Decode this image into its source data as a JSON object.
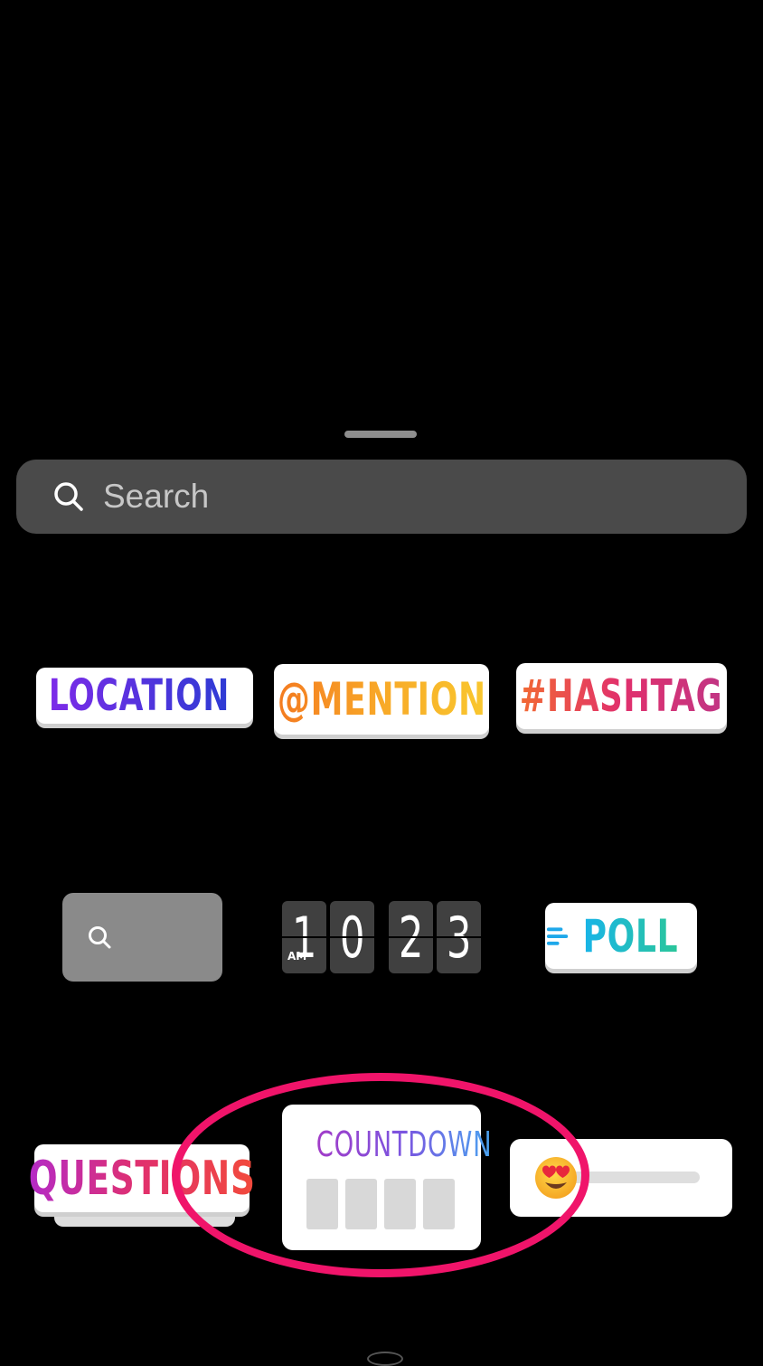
{
  "search": {
    "placeholder": "Search"
  },
  "stickers": {
    "location": "LOCATION",
    "mention": "@MENTION",
    "hashtag": "#HASHTAG",
    "clock": {
      "ampm": "AM",
      "digits": [
        "1",
        "0",
        "2",
        "3"
      ]
    },
    "poll": "POLL",
    "questions": "QUESTIONS",
    "countdown": "COUNTDOWN",
    "emoji_slider_emoji": "😍"
  },
  "colors": {
    "background": "#000000",
    "search_bg": "#4a4a4a",
    "highlight_circle": "#f0146a"
  },
  "icons": [
    "search-icon",
    "location-pin-icon",
    "gif-search-icon",
    "poll-lines-icon",
    "heart-eyes-emoji-icon"
  ]
}
